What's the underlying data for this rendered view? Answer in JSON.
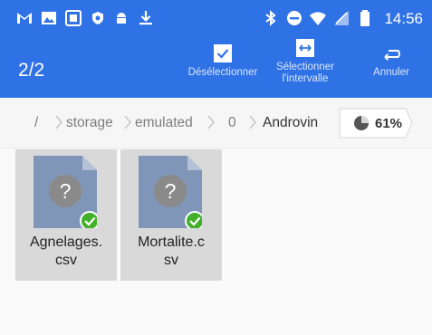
{
  "status_bar": {
    "time": "14:56",
    "left_icons": [
      "gmail-icon",
      "image-icon",
      "app-box-icon",
      "shield-icon",
      "android-icon",
      "download-icon"
    ],
    "right_icons": [
      "bluetooth-icon",
      "do-not-disturb-icon",
      "wifi-icon",
      "signal-icon",
      "battery-icon"
    ]
  },
  "toolbar": {
    "selection_count": "2/2",
    "deselect_label": "Désélectionner",
    "select_range_label_line1": "Sélectionner",
    "select_range_label_line2": "l'intervalle",
    "cancel_label": "Annuler"
  },
  "breadcrumb": {
    "root": "/",
    "items": [
      "storage",
      "emulated",
      "0",
      "Androvin"
    ],
    "storage_usage": "61%"
  },
  "files": [
    {
      "name_line1": "Agnelages.",
      "name_line2": "csv",
      "selected": true,
      "icon": "unknown-file-icon"
    },
    {
      "name_line1": "Mortalite.c",
      "name_line2": "sv",
      "selected": true,
      "icon": "unknown-file-icon"
    }
  ],
  "colors": {
    "toolbar": "#2f72e6",
    "selected_tile": "#d9d9d9",
    "check_badge": "#43b02a"
  }
}
